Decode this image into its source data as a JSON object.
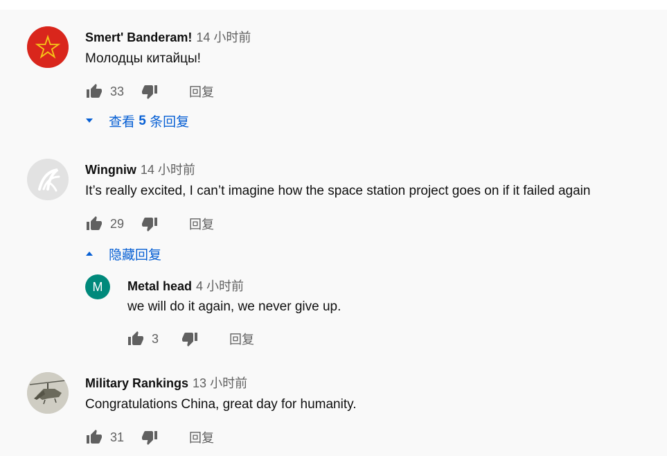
{
  "colors": {
    "link": "#065fd4",
    "meta": "#606060",
    "text": "#0f0f0f",
    "background": "#f9f9f9"
  },
  "comments": [
    {
      "author": "Smert' Banderam!",
      "time": "14 小时前",
      "text": "Молодцы китайцы!",
      "likes": "33",
      "reply_label": "回复",
      "toggle": {
        "prefix": "查看 ",
        "count": "5",
        "suffix": " 条回复",
        "icon": "caret-down-icon"
      },
      "avatar_icon": "red-star-icon"
    },
    {
      "author": "Wingniw",
      "time": "14 小时前",
      "text": "It’s really excited, I can’t imagine how the space station project goes on if it failed again",
      "likes": "29",
      "reply_label": "回复",
      "toggle": {
        "label": "隐藏回复",
        "icon": "caret-up-icon"
      },
      "avatar_icon": "swirl-logo-icon",
      "replies": [
        {
          "author": "Metal head",
          "time": "4 小时前",
          "text": "we will do it again, we never give up.",
          "likes": "3",
          "reply_label": "回复",
          "avatar_letter": "M",
          "avatar_color": "#00897b"
        }
      ]
    },
    {
      "author": "Military Rankings",
      "time": "13 小时前",
      "text": "Congratulations China, great day for humanity.",
      "likes": "31",
      "reply_label": "回复",
      "avatar_icon": "helicopter-icon"
    }
  ]
}
